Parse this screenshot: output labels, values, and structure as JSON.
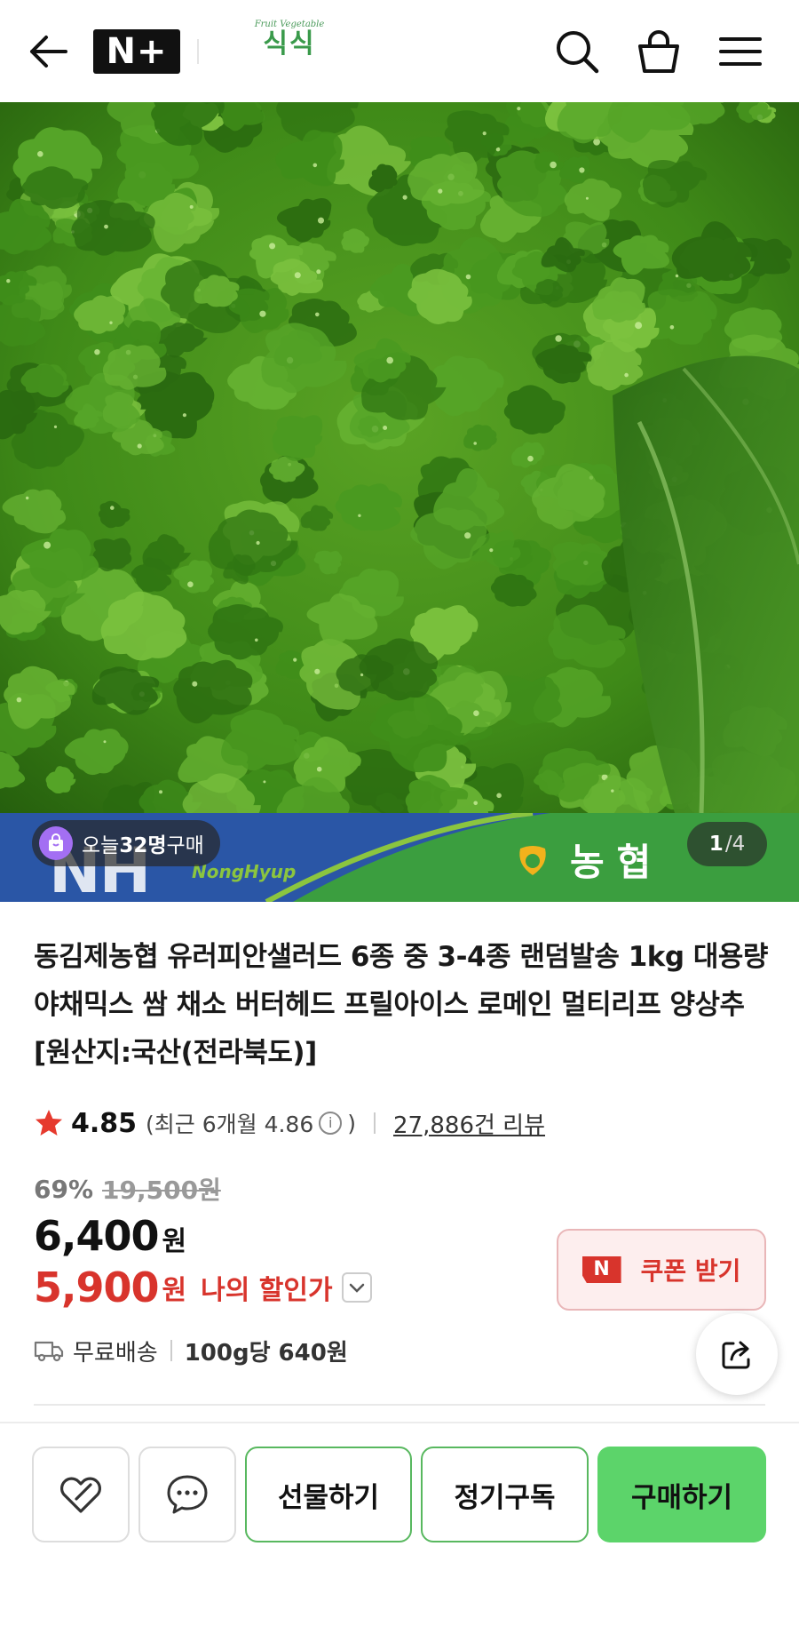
{
  "header": {
    "back_icon": "arrow-left-icon",
    "nplus_logo": "N+",
    "shop_logo": {
      "tagline": "Fruit Vegetable",
      "name": "식식"
    },
    "icons": [
      "search-icon",
      "shopping-bag-icon",
      "hamburger-menu-icon"
    ]
  },
  "hero": {
    "banner": {
      "nh_text": "NH",
      "nonghyup_text": "NongHyup",
      "brand_text": "농협",
      "colors": {
        "blue": "#2a56a6",
        "green": "#3b9e3f",
        "lime": "#8bc53f",
        "gold": "#f2b21c"
      }
    },
    "buyers": {
      "prefix": "오늘 ",
      "count": "32명",
      "suffix": " 구매"
    },
    "pager": {
      "current": "1",
      "separator": "/",
      "total": "4"
    }
  },
  "product": {
    "title": "동김제농협 유러피안샐러드 6종 중 3-4종 랜덤발송 1kg 대용량 야채믹스 쌈 채소 버터헤드 프릴아이스 로메인 멀티리프 양상추 [원산지:국산(전라북도)]",
    "rating": {
      "score": "4.85",
      "recent_label": "(최근 6개월 4.86",
      "recent_close": ")",
      "info_icon": "i",
      "reviews": "27,886건 리뷰"
    },
    "price": {
      "discount_rate": "69%",
      "original": "19,500원",
      "sale": "6,400",
      "sale_unit": "원",
      "my_price": "5,900",
      "my_price_unit": "원",
      "my_price_label": "나의 할인가"
    },
    "coupon": {
      "badge": "N",
      "label": "쿠폰 받기"
    },
    "shipping": {
      "label": "무료배송",
      "per_unit": "100g당 640원"
    }
  },
  "actions": {
    "gift": "선물하기",
    "subscribe": "정기구독",
    "buy": "구매하기"
  },
  "colors": {
    "accent_green": "#5cd46a",
    "sale_red": "#d8342c",
    "star": "#e63a2e"
  }
}
